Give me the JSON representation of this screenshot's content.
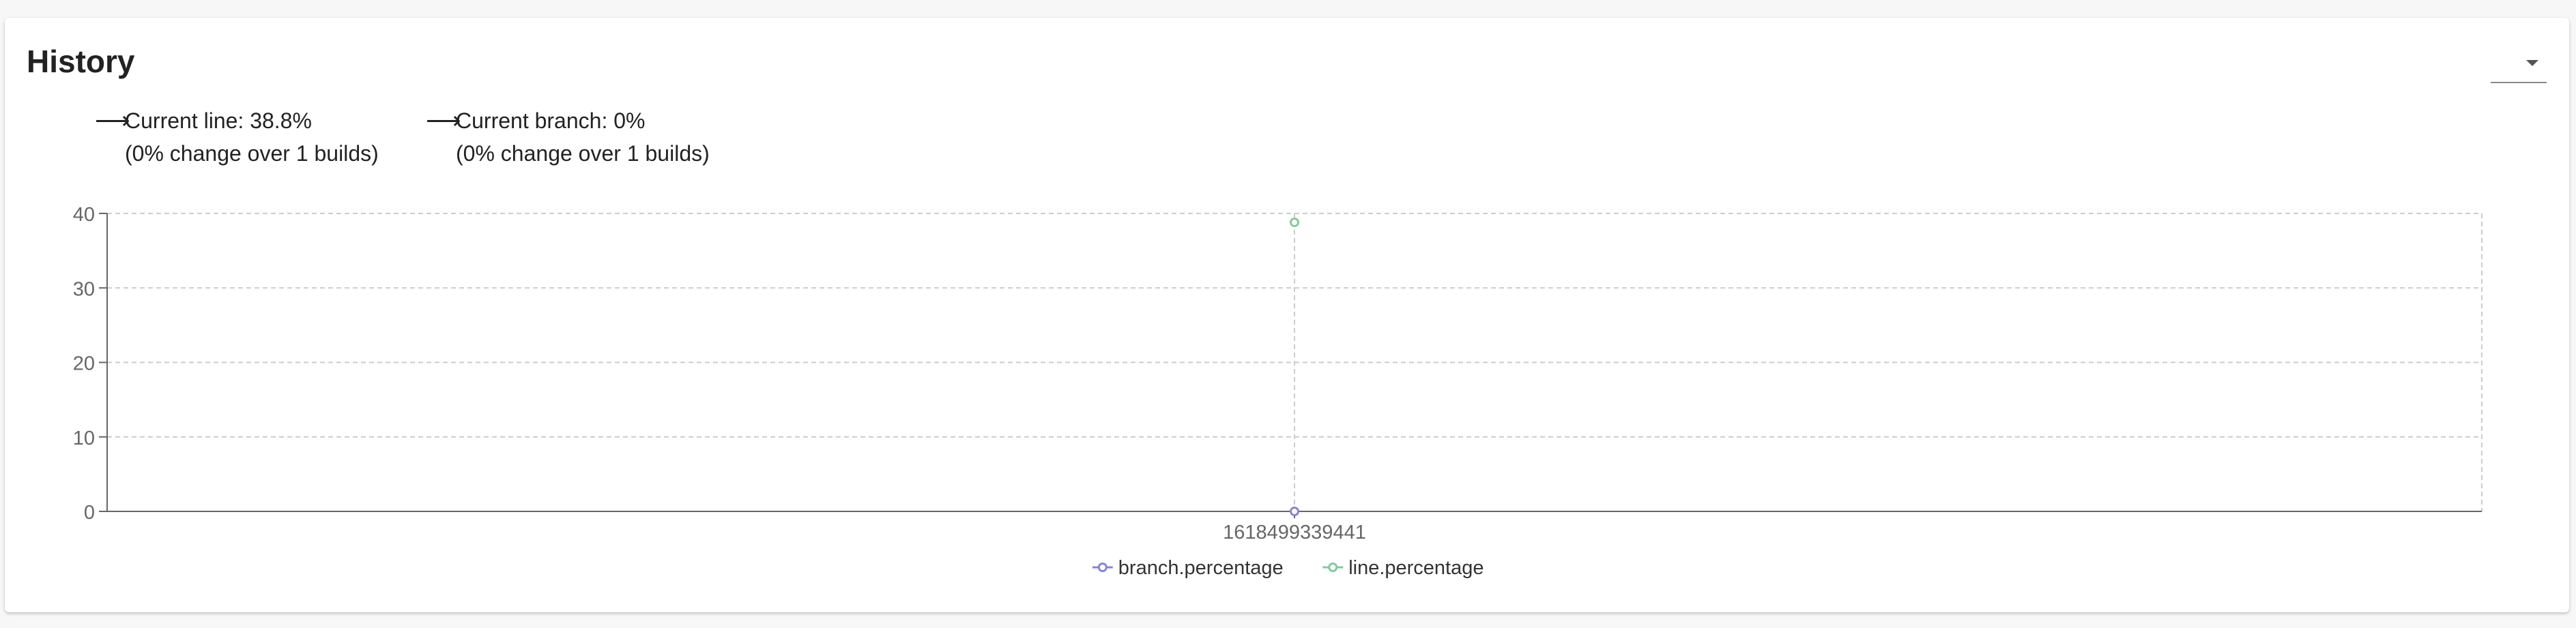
{
  "panel": {
    "title": "History"
  },
  "trends": [
    {
      "label": "Current line: 38.8%",
      "change": "(0% change over 1 builds)"
    },
    {
      "label": "Current branch: 0%",
      "change": "(0% change over 1 builds)"
    }
  ],
  "icons": {
    "trend_arrow": "right-arrow-icon",
    "menu": "caret-down-icon"
  },
  "chart_data": {
    "type": "line",
    "x": [
      "1618499339441"
    ],
    "series": [
      {
        "name": "branch.percentage",
        "values": [
          0
        ],
        "color": "#8884d8"
      },
      {
        "name": "line.percentage",
        "values": [
          38.8
        ],
        "color": "#82ca9d"
      }
    ],
    "yticks": [
      0,
      10,
      20,
      30,
      40
    ],
    "ylim": [
      0,
      40
    ],
    "grid": true,
    "legend": "bottom-center"
  }
}
